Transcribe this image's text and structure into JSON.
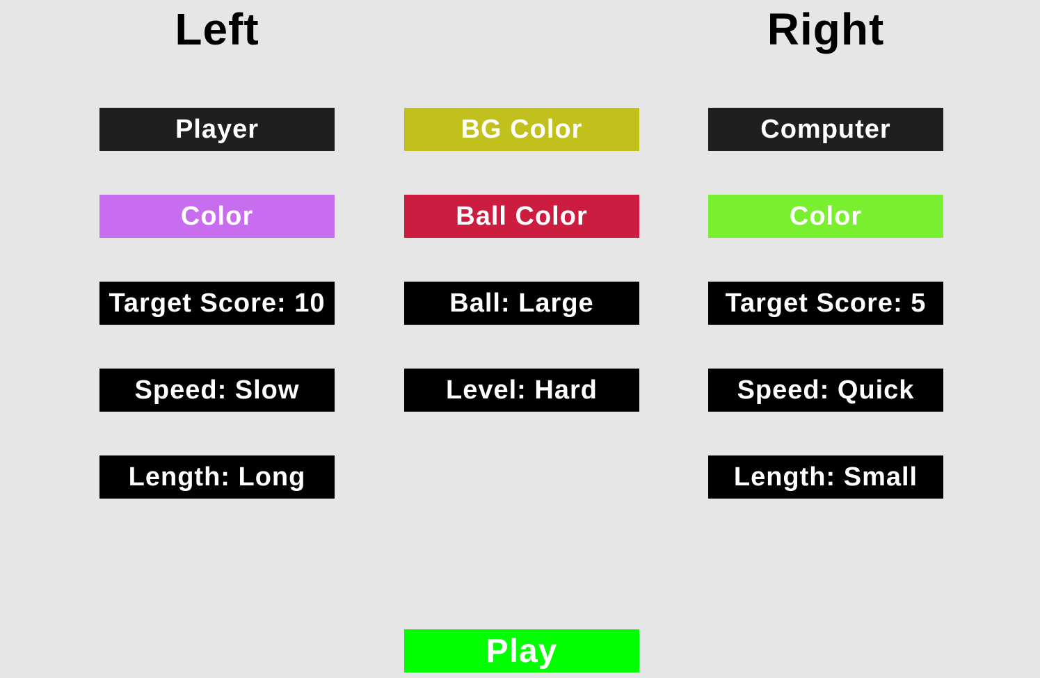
{
  "headings": {
    "left": "Left",
    "right": "Right"
  },
  "left": {
    "mode_label": "Player",
    "color_label": "Color",
    "target_score_label": "Target Score: 10",
    "speed_label": "Speed: Slow",
    "length_label": "Length: Long"
  },
  "center": {
    "bg_color_label": "BG Color",
    "ball_color_label": "Ball Color",
    "ball_size_label": "Ball: Large",
    "level_label": "Level: Hard"
  },
  "right": {
    "mode_label": "Computer",
    "color_label": "Color",
    "target_score_label": "Target Score: 5",
    "speed_label": "Speed: Quick",
    "length_label": "Length: Small"
  },
  "play_label": "Play",
  "colors": {
    "background": "#e6e6e6",
    "left_paddle": "#c86cf0",
    "right_paddle": "#78f02f",
    "bg_color_swatch": "#c2c01c",
    "ball_color_swatch": "#cc1c40",
    "play_button": "#00ff00",
    "button_dark": "#1f1f1f",
    "button_black": "#000000"
  }
}
